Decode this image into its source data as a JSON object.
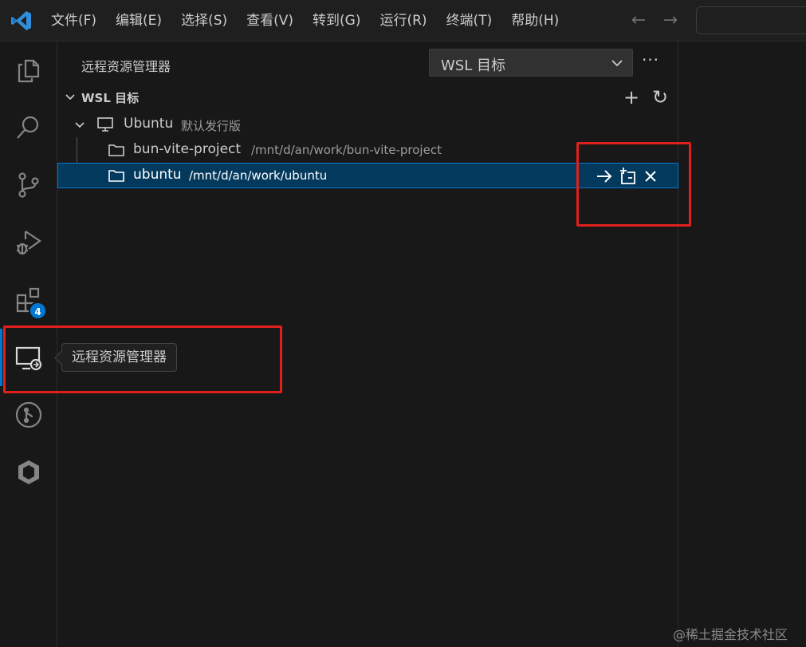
{
  "titlebar": {
    "menu": [
      "文件(F)",
      "编辑(E)",
      "选择(S)",
      "查看(V)",
      "转到(G)",
      "运行(R)",
      "终端(T)",
      "帮助(H)"
    ],
    "back_icon": "arrow-left-icon",
    "forward_icon": "arrow-right-icon"
  },
  "activitybar": {
    "items": [
      {
        "name": "explorer",
        "icon": "files-icon"
      },
      {
        "name": "search",
        "icon": "search-icon"
      },
      {
        "name": "source-control",
        "icon": "source-control-icon"
      },
      {
        "name": "run-debug",
        "icon": "debug-icon"
      },
      {
        "name": "extensions",
        "icon": "extensions-icon",
        "badge": "4"
      },
      {
        "name": "remote-explorer",
        "icon": "remote-explorer-icon",
        "active": true
      },
      {
        "name": "git",
        "icon": "git-icon"
      },
      {
        "name": "other",
        "icon": "kubernetes-icon"
      }
    ],
    "tooltip": "远程资源管理器"
  },
  "sidebar": {
    "title": "远程资源管理器",
    "select_value": "WSL 目标",
    "more_label": "···",
    "section": {
      "title": "WSL 目标",
      "add_label": "+",
      "refresh_label": "↻"
    },
    "distro": {
      "name": "Ubuntu",
      "desc": "默认发行版"
    },
    "folders": [
      {
        "name": "bun-vite-project",
        "path": "/mnt/d/an/work/bun-vite-project",
        "selected": false
      },
      {
        "name": "ubuntu",
        "path": "/mnt/d/an/work/ubuntu",
        "selected": true
      }
    ],
    "row_actions": [
      "open-in-current-window-icon",
      "open-in-new-window-icon",
      "remove-icon"
    ]
  },
  "colors": {
    "accent": "#0078d4",
    "selection": "#04395e",
    "annotation": "#e0201c"
  },
  "watermark": "@稀土掘金技术社区"
}
